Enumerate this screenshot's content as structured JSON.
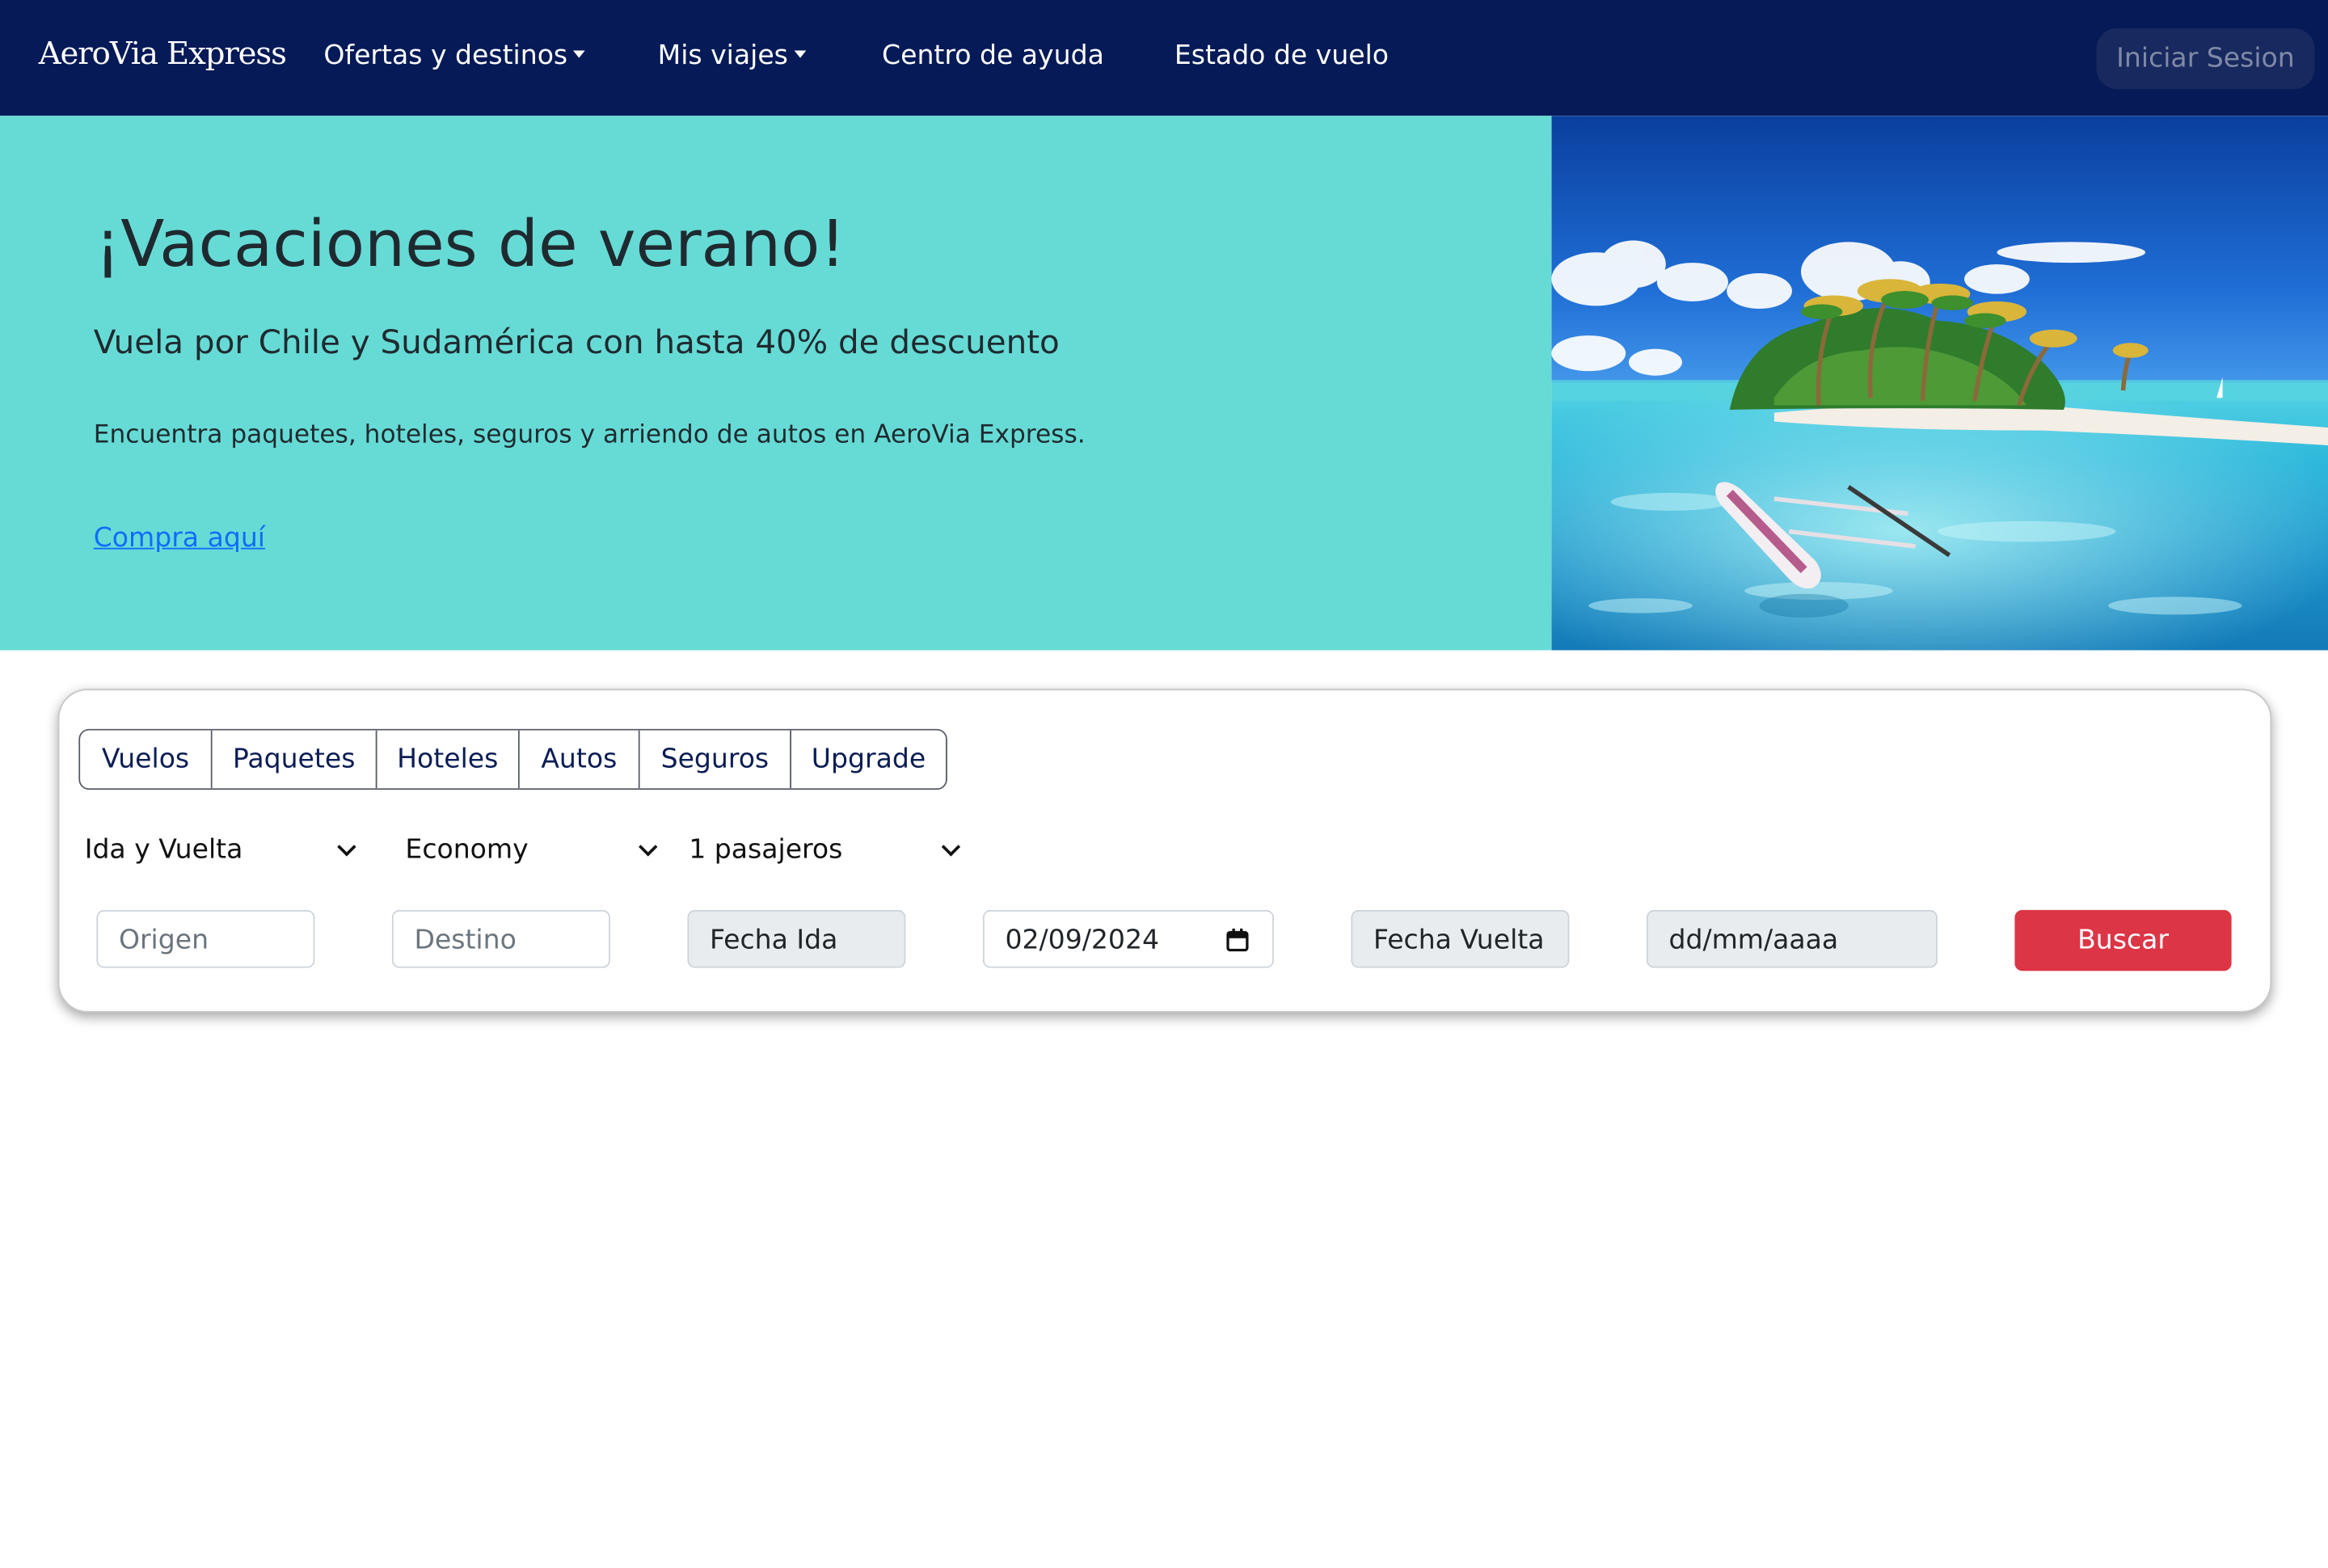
{
  "navbar": {
    "brand": "AeroVia Express",
    "items": [
      {
        "label": "Ofertas y destinos",
        "dropdown": true
      },
      {
        "label": "Mis viajes",
        "dropdown": true
      },
      {
        "label": "Centro de ayuda",
        "dropdown": false
      },
      {
        "label": "Estado de vuelo",
        "dropdown": false
      }
    ],
    "login_label": "Iniciar Sesion"
  },
  "hero": {
    "title": "¡Vacaciones de verano!",
    "subtitle": "Vuela por Chile y Sudamérica con hasta 40% de descuento",
    "text": "Encuentra paquetes, hoteles, seguros y arriendo de autos en AeroVia Express.",
    "link": "Compra aquí",
    "image": "tropical-island-beach-photo"
  },
  "search": {
    "tabs": [
      "Vuelos",
      "Paquetes",
      "Hoteles",
      "Autos",
      "Seguros",
      "Upgrade"
    ],
    "trip_type": "Ida y Vuelta",
    "cabin_class": "Economy",
    "passengers": "1 pasajeros",
    "origin_placeholder": "Origen",
    "destination_placeholder": "Destino",
    "departure_label": "Fecha Ida",
    "departure_value": "02/09/2024",
    "return_label": "Fecha Vuelta",
    "return_value": "dd/mm/aaaa",
    "search_label": "Buscar"
  },
  "colors": {
    "navbar_bg": "#061a57",
    "hero_bg": "#66dbd5",
    "link": "#0d6efd",
    "search_button": "#dc3545"
  }
}
